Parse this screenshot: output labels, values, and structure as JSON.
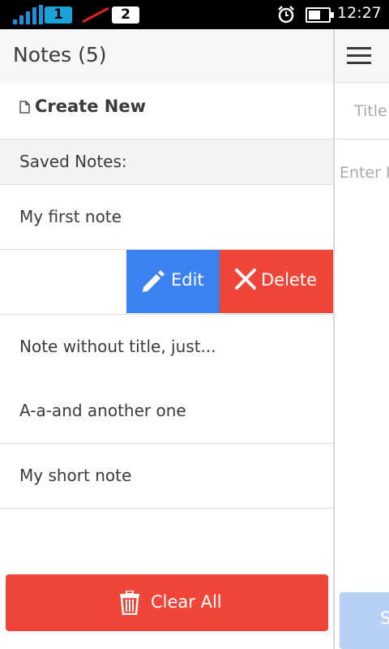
{
  "status": {
    "sim1": "1",
    "sim2": "2",
    "time": "12:27",
    "icons": [
      "signal-icon",
      "no-signal-icon",
      "alarm-icon",
      "battery-icon"
    ]
  },
  "list_panel": {
    "title": "Notes (5)",
    "create_label": "Create New",
    "saved_label": "Saved Notes:",
    "notes": [
      "My first note",
      "Note without title, just...",
      "A-a-and another one",
      "My short note"
    ],
    "edit_label": "Edit",
    "delete_label": "Delete",
    "clear_label": "Clear All"
  },
  "editor_panel": {
    "title_placeholder": "Title",
    "text_placeholder": "Enter N",
    "save_label": "S"
  },
  "colors": {
    "edit": "#3b82f0",
    "delete": "#ef4639",
    "clear": "#ef4639",
    "save_disabled": "#b8d0f6"
  }
}
